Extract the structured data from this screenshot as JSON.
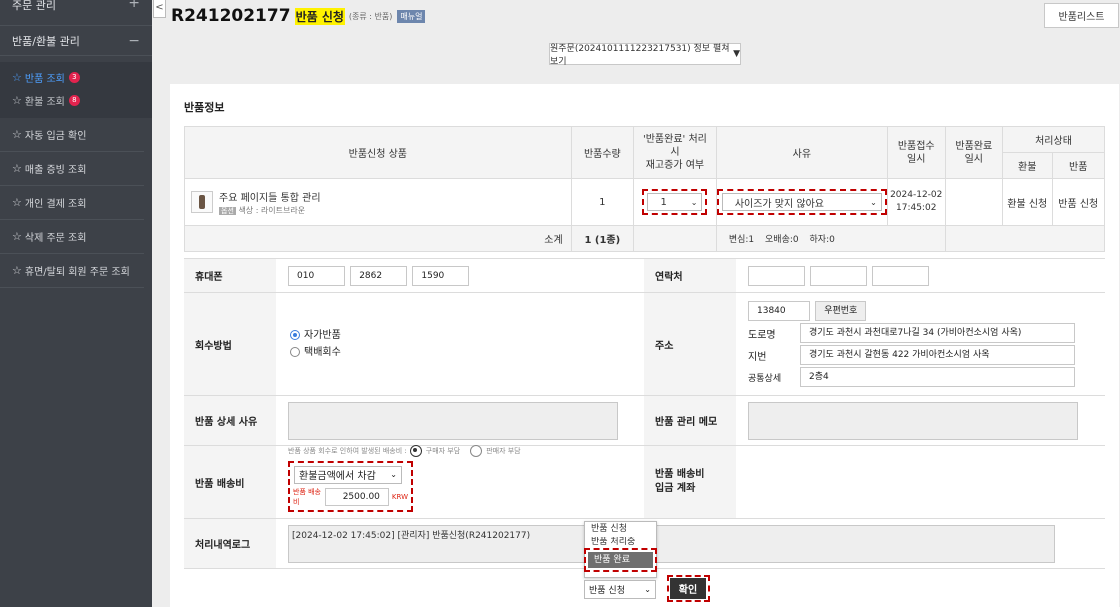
{
  "sidebar": {
    "order_mgmt": "주문 관리",
    "order_mgmt_toggle": "+",
    "return_mgmt": "반품/환불 관리",
    "return_mgmt_toggle": "−",
    "sub_items": [
      {
        "label": "반품 조회",
        "badge": "3"
      },
      {
        "label": "환불 조회",
        "badge": "8"
      }
    ],
    "items": [
      {
        "label": "자동 입금 확인"
      },
      {
        "label": "매출 증빙 조회"
      },
      {
        "label": "개인 결제 조회"
      },
      {
        "label": "삭제 주문 조회"
      },
      {
        "label": "휴면/탈퇴 회원 주문 조회"
      }
    ]
  },
  "header": {
    "collapse": "<",
    "code": "R241202177",
    "status": "반품 신청",
    "kind": "(종류 : 반품)",
    "manual": "매뉴얼",
    "list_button": "반품리스트",
    "order_button": "원주문(20241011112232​17531) 정보 펼쳐보기",
    "order_button_arrow": "▼"
  },
  "section_title": "반품정보",
  "items_table": {
    "headers": {
      "product": "반품신청 상품",
      "qty": "반품수량",
      "restock_1": "'반품완료' 처리",
      "restock_2": "시",
      "restock_3": "재고증가 여부",
      "reason": "사유",
      "received_1": "반품접수",
      "received_2": "일시",
      "done_1": "반품완료",
      "done_2": "일시",
      "status": "처리상태",
      "refund": "환불",
      "return": "반품"
    },
    "row": {
      "name": "주요 페이지들 통합 관리",
      "option_tag": "옵션",
      "option": "색상 : 라이트브라운",
      "qty": "1",
      "restock": "1",
      "reason": "사이즈가 맞지 않아요",
      "date": "2024-12-02",
      "time": "17:45:02",
      "refund_status": "환불 신청",
      "return_status": "반품 신청"
    },
    "subtotal": {
      "label": "소계",
      "qty": "1 (1종)",
      "change": "변심:1",
      "misdelivery": "오배송:0",
      "defect": "하자:0"
    }
  },
  "form": {
    "phone_label": "휴대폰",
    "phone": [
      "010",
      "2862",
      "1590"
    ],
    "contact_label": "연락처",
    "contact": [
      "",
      "",
      ""
    ],
    "method_label": "회수방법",
    "method_self": "자가반품",
    "method_courier": "택배회수",
    "address_label": "주소",
    "zipcode": "13840",
    "zip_button": "우편번호",
    "road_label": "도로명",
    "road": "경기도 과천시 과천대로7나길 34 (가비아컨소시엄 사옥)",
    "jibun_label": "지번",
    "jibun": "경기도 과천시 갈현동 422 가비아컨소시엄 사옥",
    "detail_label": "공통상세",
    "detail": "2층4",
    "reason_label": "반품 상세 사유",
    "memo_label": "반품 관리 메모",
    "fee_label": "반품 배송비",
    "fee_note": "반품 상품 회수로 인하여 발생된 배송비 :",
    "fee_buyer": "구매자 부담",
    "fee_seller": "판매자 부담",
    "fee_method": "환불금액에서 차감",
    "fee_amount_label": "반품 배송비",
    "fee_amount": "2500.00",
    "fee_currency": "KRW",
    "fee_account_label_1": "반품 배송비",
    "fee_account_label_2": "입금 계좌",
    "log_label": "처리내역로그",
    "log": "[2024-12-02 17:45:02] [관리자]  반품신청(R241202177)"
  },
  "dropdown": {
    "options": [
      "반품 신청",
      "반품 처리중",
      "반품 완료"
    ],
    "selected_index": 2,
    "current": "반품 신청"
  },
  "confirm_button": "확인"
}
